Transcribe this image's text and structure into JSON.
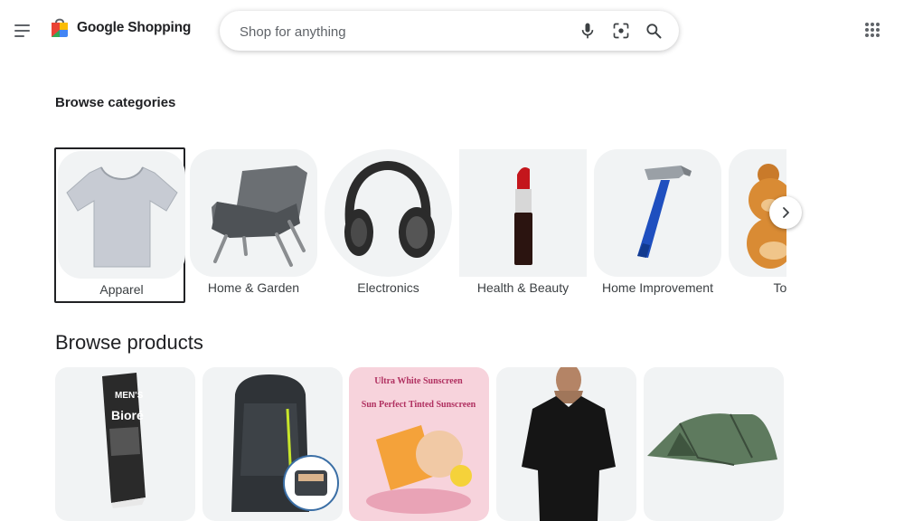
{
  "header": {
    "logo_text": "Google Shopping",
    "search_placeholder": "Shop for anything"
  },
  "browse_categories": {
    "title": "Browse categories",
    "items": [
      {
        "label": "Apparel",
        "selected": true
      },
      {
        "label": "Home & Garden"
      },
      {
        "label": "Electronics"
      },
      {
        "label": "Health & Beauty"
      },
      {
        "label": "Home Improvement"
      },
      {
        "label": "Toys &"
      }
    ]
  },
  "browse_products": {
    "title": "Browse products",
    "items": [
      {
        "brand_text": "MEN'S",
        "name_text": "Bioré"
      },
      {},
      {
        "headline_1": "Ultra White Sunscreen",
        "headline_2": "Sun Perfect Tinted Sunscreen"
      },
      {},
      {}
    ]
  },
  "colors": {
    "accent_blue": "#4285f4",
    "text": "#202124",
    "tile_bg": "#f1f3f4"
  }
}
